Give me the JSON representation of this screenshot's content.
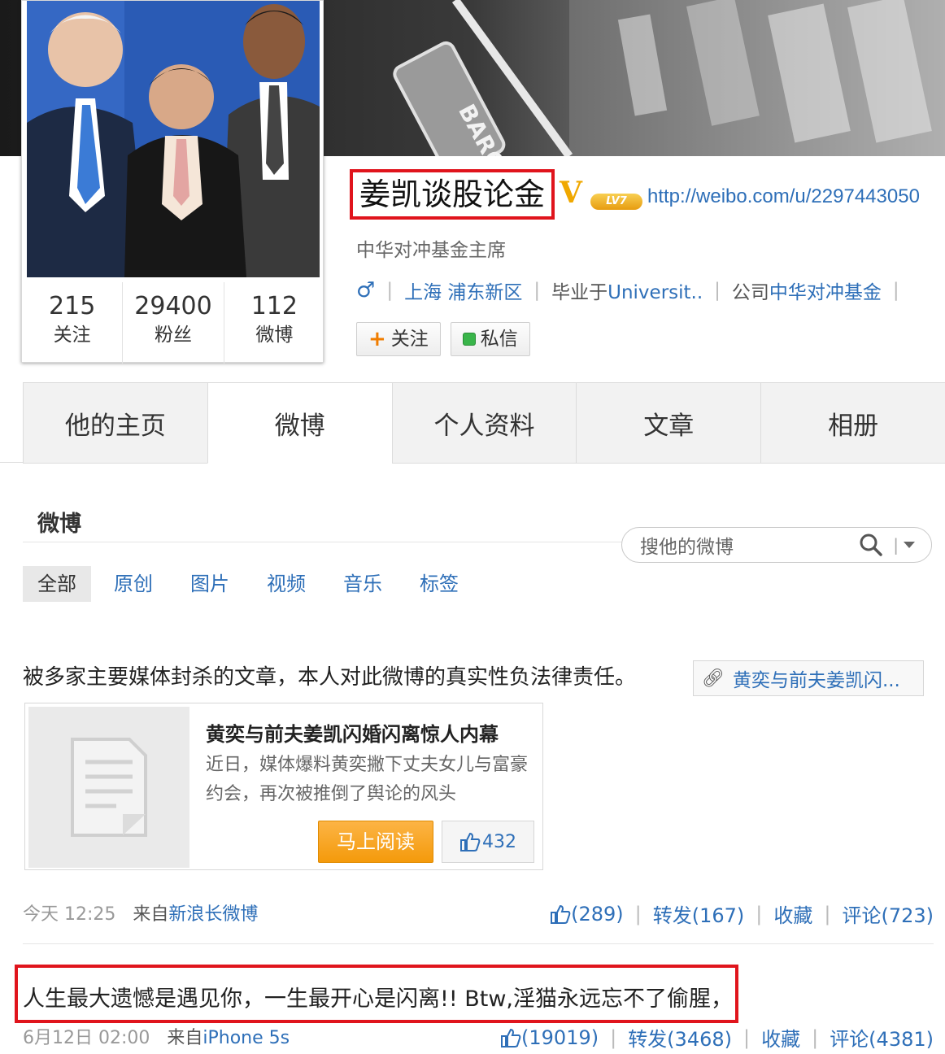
{
  "cover": {
    "sign_text": "BARC"
  },
  "profile": {
    "name": "姜凯谈股论金",
    "verified_mark": "V",
    "level_badge": "LV7",
    "url": "http://weibo.com/u/2297443050",
    "bio": "中华对冲基金主席",
    "gender_icon": "male-icon",
    "location": "上海 浦东新区",
    "education": "毕业于Universit..",
    "company_label": "公司",
    "company": "中华对冲基金",
    "follow_button": "关注",
    "message_button": "私信"
  },
  "counts": [
    {
      "value": "215",
      "label": "关注"
    },
    {
      "value": "29400",
      "label": "粉丝"
    },
    {
      "value": "112",
      "label": "微博"
    }
  ],
  "tabs": [
    {
      "label": "他的主页",
      "active": false
    },
    {
      "label": "微博",
      "active": true
    },
    {
      "label": "个人资料",
      "active": false
    },
    {
      "label": "文章",
      "active": false
    },
    {
      "label": "相册",
      "active": false
    }
  ],
  "feed": {
    "title": "微博",
    "search_placeholder": "搜他的微博",
    "filters": [
      "全部",
      "原创",
      "图片",
      "视频",
      "音乐",
      "标签"
    ]
  },
  "posts": [
    {
      "text": "被多家主要媒体封杀的文章，本人对此微博的真实性负法律责任。",
      "link_label": "黄奕与前夫姜凯闪...",
      "article": {
        "title": "黄奕与前夫姜凯闪婚闪离惊人内幕",
        "desc": "近日，媒体爆料黄奕撇下丈夫女儿与富豪约会，再次被推倒了舆论的风头",
        "read_button": "马上阅读",
        "likes": "432"
      },
      "time": "今天 12:25",
      "source_prefix": "来自",
      "source": "新浪长微博",
      "like_count": "(289)",
      "repost": "转发(167)",
      "favorite": "收藏",
      "comment": "评论(723)"
    },
    {
      "text": "人生最大遗憾是遇见你，一生最开心是闪离!! Btw,淫猫永远忘不了偷腥，",
      "time": "6月12日 02:00",
      "source_prefix": "来自",
      "source": "iPhone 5s",
      "like_count": "(19019)",
      "repost": "转发(3468)",
      "favorite": "收藏",
      "comment": "评论(4381)"
    }
  ],
  "colors": {
    "link": "#2e6fb8",
    "highlight_box": "#e0141c",
    "read_button": "#f49a0b",
    "verified": "#f0a800"
  }
}
